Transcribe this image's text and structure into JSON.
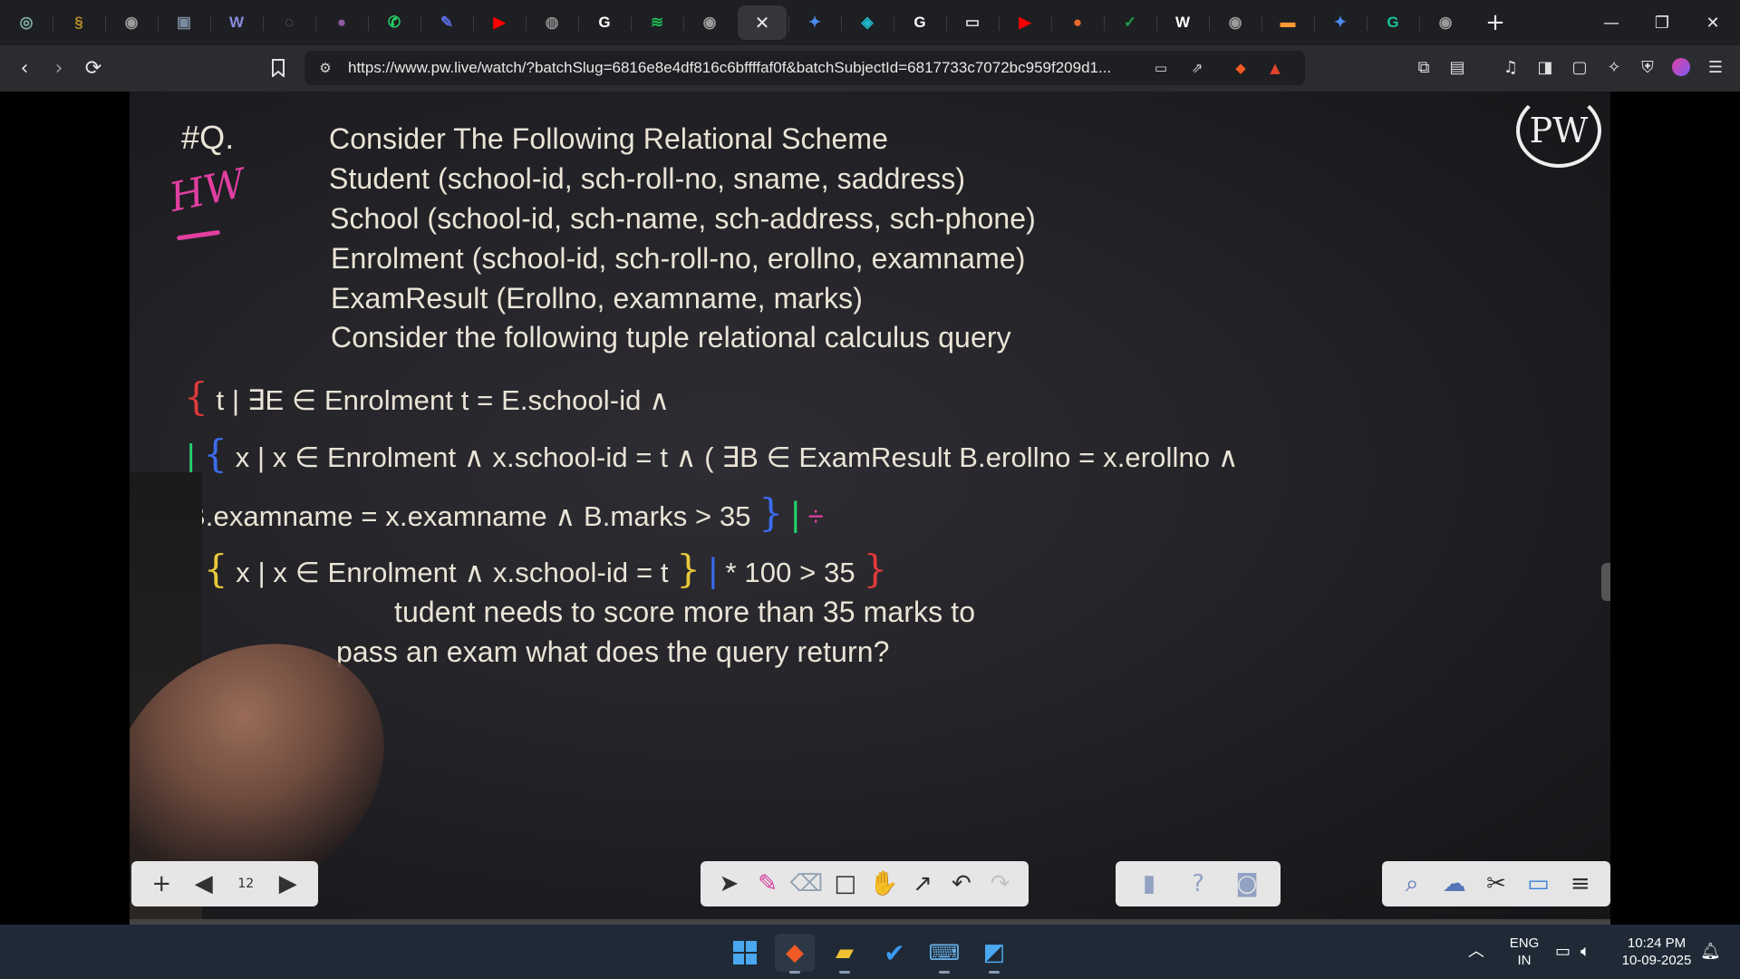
{
  "browser": {
    "tabs": [
      {
        "icon": "chatgpt-icon",
        "color": "#7fb3a4",
        "glyph": "◎"
      },
      {
        "icon": "circle-logo-icon",
        "color": "#b58a2a",
        "glyph": "§"
      },
      {
        "icon": "globe-icon",
        "color": "#9a9a9a",
        "glyph": "◉"
      },
      {
        "icon": "app-icon",
        "color": "#7a8aa0",
        "glyph": "▣"
      },
      {
        "icon": "wordpress-icon",
        "color": "#8a8ae0",
        "glyph": "W"
      },
      {
        "icon": "ring-icon",
        "color": "#6a6a6a",
        "glyph": "◌"
      },
      {
        "icon": "planet-icon",
        "color": "#8a5aa0",
        "glyph": "●"
      },
      {
        "icon": "whatsapp-icon",
        "color": "#25d366",
        "glyph": "✆"
      },
      {
        "icon": "feather-icon",
        "color": "#5a6ae0",
        "glyph": "✎"
      },
      {
        "icon": "youtube-icon",
        "color": "#ff0000",
        "glyph": "▶"
      },
      {
        "icon": "globe-icon",
        "color": "#8a8a8a",
        "glyph": "◍"
      },
      {
        "icon": "google-icon",
        "color": "#ffffff",
        "glyph": "G"
      },
      {
        "icon": "spotify-icon",
        "color": "#1db954",
        "glyph": "≋"
      },
      {
        "icon": "globe-icon",
        "color": "#9a9a9a",
        "glyph": "◉"
      },
      {
        "icon": "close-icon",
        "active": true,
        "glyph": "✕"
      },
      {
        "icon": "gemini-icon",
        "color": "#4a8af0",
        "glyph": "✦"
      },
      {
        "icon": "perplexity-icon",
        "color": "#20b8cd",
        "glyph": "◈"
      },
      {
        "icon": "google-icon",
        "color": "#ffffff",
        "glyph": "G"
      },
      {
        "icon": "monitor-icon",
        "color": "#d8d8d8",
        "glyph": "▭"
      },
      {
        "icon": "youtube-icon",
        "color": "#ff0000",
        "glyph": "▶"
      },
      {
        "icon": "globe-orange-icon",
        "color": "#e86a2a",
        "glyph": "●"
      },
      {
        "icon": "excel-icon",
        "color": "#1d9e4a",
        "glyph": "✓"
      },
      {
        "icon": "wikipedia-icon",
        "color": "#ffffff",
        "glyph": "W"
      },
      {
        "icon": "globe-icon",
        "color": "#9a9a9a",
        "glyph": "◉"
      },
      {
        "icon": "india-flag-icon",
        "color": "#ff9933",
        "glyph": "▬"
      },
      {
        "icon": "gemini-icon",
        "color": "#4a8af0",
        "glyph": "✦"
      },
      {
        "icon": "grammarly-icon",
        "color": "#15c39a",
        "glyph": "G"
      },
      {
        "icon": "globe-icon",
        "color": "#9a9a9a",
        "glyph": "◉"
      }
    ],
    "new_tab": "+",
    "url": "https://www.pw.live/watch/?batchSlug=6816e8e4df816c6bffffaf0f&batchSubjectId=6817733c7072bc959f209d1..."
  },
  "video": {
    "heading": "#Q.",
    "hw_mark": "HW",
    "logo_text": "PW",
    "lines": [
      "Consider The Following Relational Scheme",
      "Student (school-id, sch-roll-no, sname, saddress)",
      "School (school-id, sch-name, sch-address, sch-phone)",
      "Enrolment (school-id, sch-roll-no, erollno, examname)",
      "ExamResult (Erollno, examname, marks)",
      "Consider the following tuple relational calculus query"
    ],
    "query": {
      "l1_brace": "{",
      "l1": "t | ∃E ∈ Enrolment t = E.school-id ∧",
      "l2_bar": "|",
      "l2_brace": "{",
      "l2": "x | x ∈ Enrolment ∧ x.school-id = t ∧ ( ∃B ∈ ExamResult B.erollno = x.erollno ∧",
      "l3": "B.examname = x.examname ∧ B.marks > 35",
      "l3_brace": "}",
      "l3_bar": "|",
      "l3_div": "÷",
      "l4_bar": "|",
      "l4_brace": "{",
      "l4": "x | x ∈ Enrolment ∧ x.school-id = t",
      "l4_brace_close": "}",
      "l4_bar_close": "|",
      "l4_tail": "* 100 > 35",
      "l4_end_brace": "}"
    },
    "question": [
      "tudent needs to score more than 35 marks to",
      "pass an exam what does the query return?"
    ],
    "page_number": "12",
    "colors": {
      "text": "#e9e4d6",
      "red": "#e03a3a",
      "pink": "#e13fa1",
      "blue": "#3c6cf0",
      "green": "#22d16a",
      "yellow": "#e8c93a"
    }
  },
  "taskbar": {
    "lang_top": "ENG",
    "lang_bottom": "IN",
    "time": "10:24 PM",
    "date": "10-09-2025"
  }
}
